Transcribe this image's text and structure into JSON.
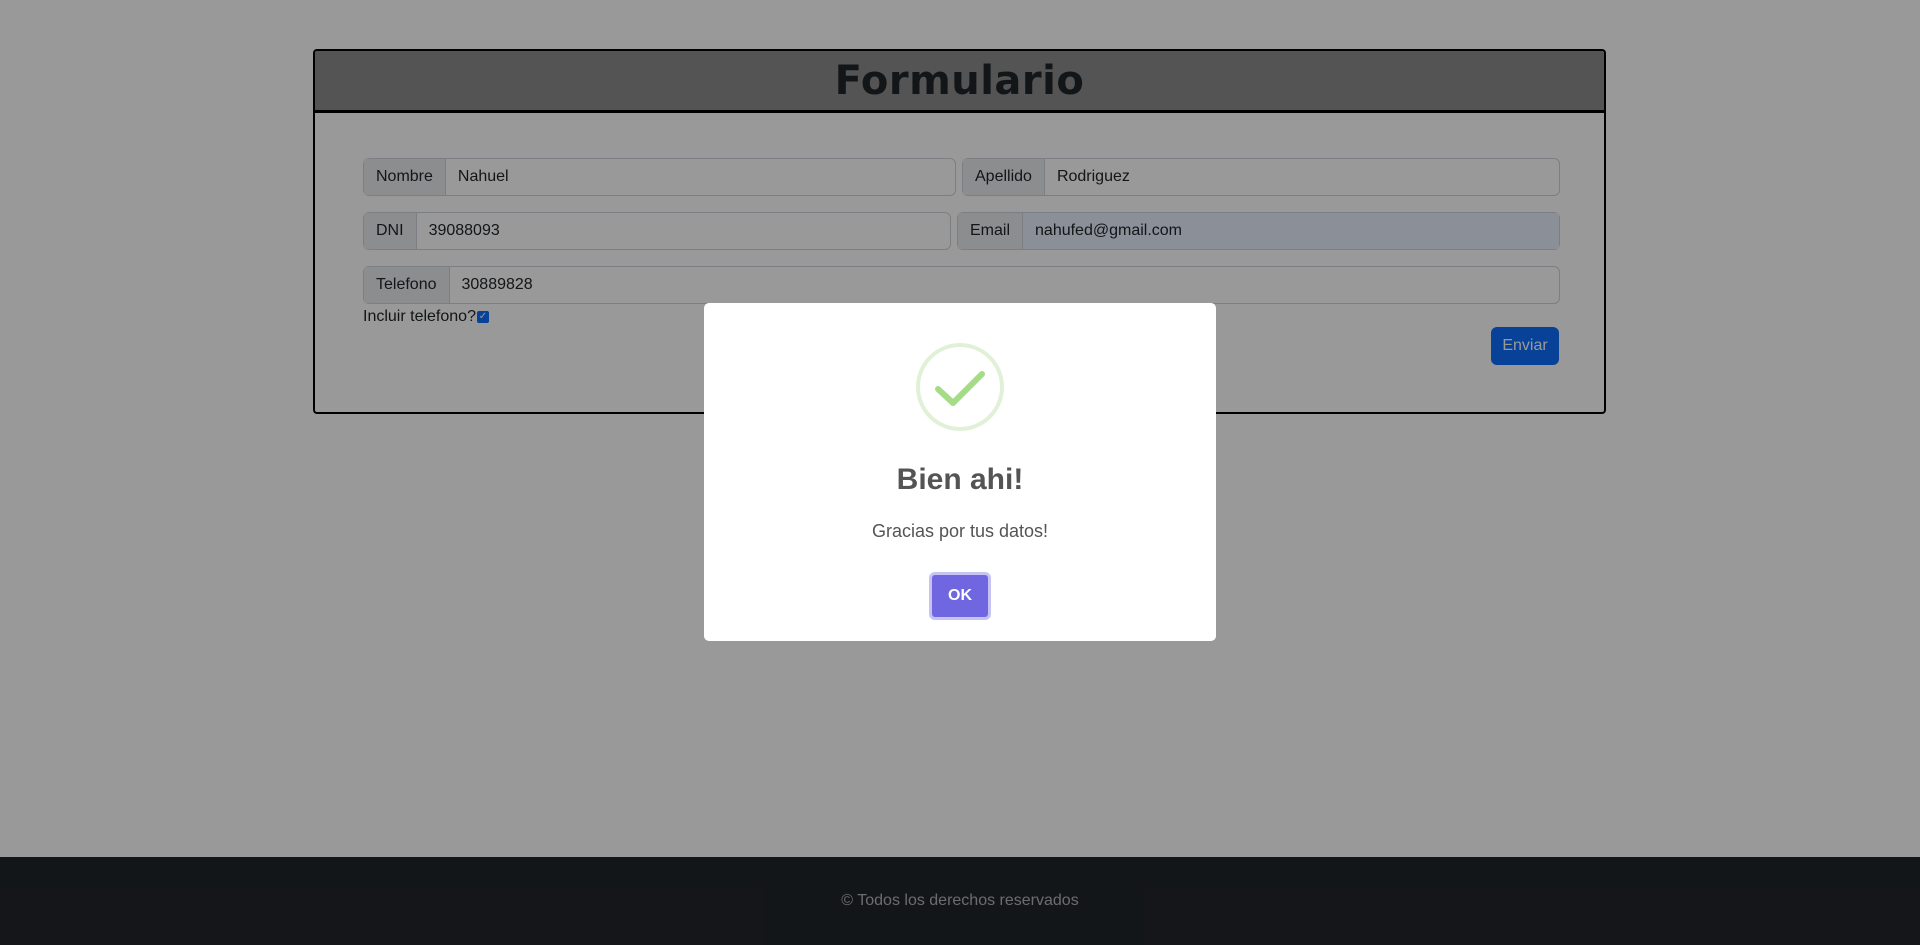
{
  "form": {
    "title": "Formulario",
    "fields": {
      "nombre": {
        "label": "Nombre",
        "value": "Nahuel"
      },
      "apellido": {
        "label": "Apellido",
        "value": "Rodriguez"
      },
      "dni": {
        "label": "DNI",
        "value": "39088093"
      },
      "email": {
        "label": "Email",
        "value": "nahufed@gmail.com"
      },
      "telefono": {
        "label": "Telefono",
        "value": "30889828"
      }
    },
    "include_phone_label": "Incluir telefono?",
    "include_phone_checked": true,
    "submit_label": "Enviar"
  },
  "footer": {
    "text": "© Todos los derechos reservados"
  },
  "modal": {
    "icon": "success-check-icon",
    "title": "Bien ahi!",
    "text": "Gracias por tus datos!",
    "ok_label": "OK"
  },
  "colors": {
    "primary": "#0d6efd",
    "footer_bg": "#212529",
    "modal_confirm": "#7066e0",
    "success": "#a5dc86"
  }
}
